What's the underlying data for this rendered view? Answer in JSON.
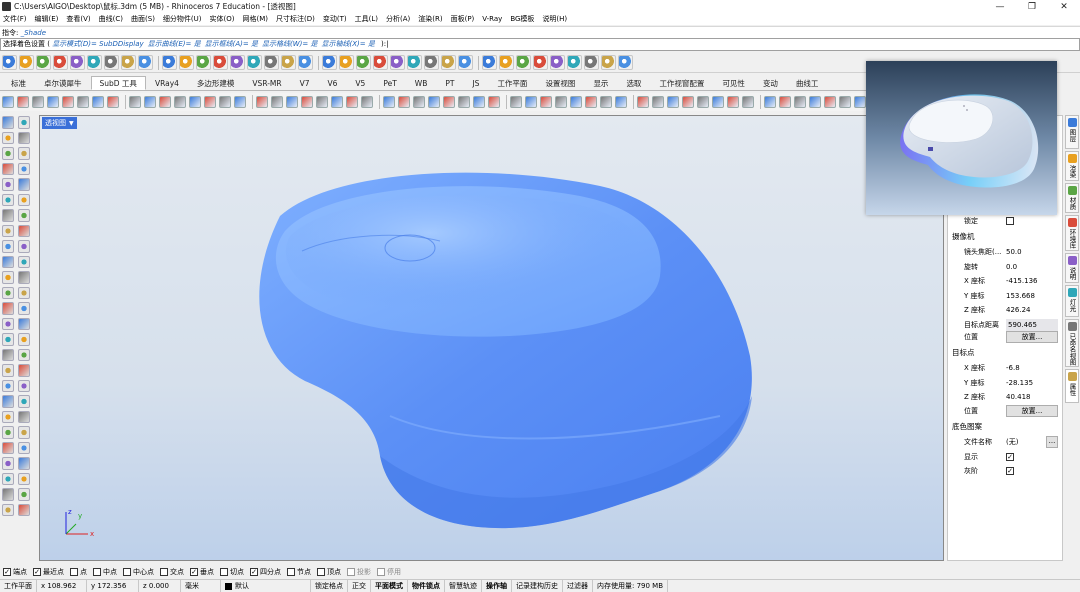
{
  "window": {
    "title": "C:\\Users\\AIGO\\Desktop\\鼠标.3dm (5 MB) - Rhinoceros 7 Education - [透视图]",
    "minimize": "—",
    "restore": "❐",
    "close": "✕"
  },
  "menu": [
    "文件(F)",
    "编辑(E)",
    "查看(V)",
    "曲线(C)",
    "曲面(S)",
    "细分物件(U)",
    "实体(O)",
    "网格(M)",
    "尺寸标注(D)",
    "变动(T)",
    "工具(L)",
    "分析(A)",
    "渲染(R)",
    "面板(P)",
    "V-Ray",
    "BG模板",
    "说明(H)"
  ],
  "command": {
    "history_label": "指令: ",
    "history_value": "_Shade",
    "prompt_label": "选择着色设置 ( ",
    "prompt_options": [
      "显示模式(D)= SubDDisplay",
      "显示曲线(E)= 是",
      "显示框线(A)= 是",
      "显示格线(W)= 是",
      "显示轴线(X)= 是"
    ],
    "prompt_end": " ):"
  },
  "tabs": [
    "标准",
    "卓尔谟犀牛",
    "SubD 工具",
    "VRay4",
    "多边形建模",
    "VSR-MR",
    "V7",
    "V6",
    "V5",
    "PeT",
    "WB",
    "PT",
    "JS",
    "工作平面",
    "设置视图",
    "显示",
    "选取",
    "工作视窗配置",
    "可见性",
    "变动",
    "曲线工"
  ],
  "active_tab": "SubD 工具",
  "viewport": {
    "label": "透视图",
    "axis_x": "x",
    "axis_y": "y",
    "axis_z": "z"
  },
  "properties": {
    "lock": {
      "label": "锁定",
      "checked": false
    },
    "camera_title": "摄像机",
    "camera": [
      {
        "label": "镜头焦距(...",
        "value": "50.0"
      },
      {
        "label": "旋转",
        "value": "0.0"
      },
      {
        "label": "X 座标",
        "value": "-415.136"
      },
      {
        "label": "Y 座标",
        "value": "153.668"
      },
      {
        "label": "Z 座标",
        "value": "426.24"
      },
      {
        "label": "目标点距离",
        "value": "590.465"
      }
    ],
    "camera_position": {
      "label": "位置",
      "button": "放置..."
    },
    "target_title": "目标点",
    "target": [
      {
        "label": "X 座标",
        "value": "-6.8"
      },
      {
        "label": "Y 座标",
        "value": "-28.135"
      },
      {
        "label": "Z 座标",
        "value": "40.418"
      }
    ],
    "target_position": {
      "label": "位置",
      "button": "放置..."
    },
    "wallpaper_title": "底色图案",
    "filename": {
      "label": "文件名称",
      "value": "(无)",
      "button": "..."
    },
    "show": {
      "label": "显示",
      "checked": true
    },
    "gray": {
      "label": "灰阶",
      "checked": true
    }
  },
  "side_tabs": [
    "图层",
    "渲染",
    "材质",
    "环境库",
    "说明",
    "灯光",
    "已命名视图",
    "属性"
  ],
  "osnaps": [
    {
      "label": "端点",
      "checked": true
    },
    {
      "label": "最近点",
      "checked": true
    },
    {
      "label": "点",
      "checked": false
    },
    {
      "label": "中点",
      "checked": false
    },
    {
      "label": "中心点",
      "checked": false
    },
    {
      "label": "交点",
      "checked": false
    },
    {
      "label": "垂点",
      "checked": true
    },
    {
      "label": "切点",
      "checked": false
    },
    {
      "label": "四分点",
      "checked": true
    },
    {
      "label": "节点",
      "checked": false
    },
    {
      "label": "顶点",
      "checked": false
    },
    {
      "label": "投影",
      "checked": false,
      "disabled": true
    },
    {
      "label": "停用",
      "checked": false,
      "disabled": true
    }
  ],
  "status": {
    "cplane": "工作平面",
    "x": "x 108.962",
    "y": "y 172.356",
    "z": "z 0.000",
    "units": "毫米",
    "layer": "默认",
    "toggles": [
      {
        "label": "锁定格点",
        "bold": false
      },
      {
        "label": "正交",
        "bold": false
      },
      {
        "label": "平面模式",
        "bold": true
      },
      {
        "label": "物件锁点",
        "bold": true
      },
      {
        "label": "智慧轨迹",
        "bold": false
      },
      {
        "label": "操作轴",
        "bold": true
      },
      {
        "label": "记录建构历史",
        "bold": false
      },
      {
        "label": "过滤器",
        "bold": false
      }
    ],
    "memory": "内存使用量: 790 MB"
  },
  "colors": {
    "accent": "#3a6fd8",
    "model": "#5a8ff5"
  }
}
